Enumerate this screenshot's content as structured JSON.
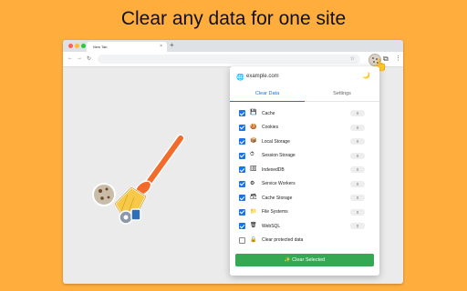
{
  "headline": "Clear any data for one site",
  "browser": {
    "tab_title": "New Tab",
    "tab_close": "×",
    "new_tab": "+",
    "nav": {
      "back": "←",
      "forward": "→",
      "reload": "↻"
    },
    "star": "☆",
    "puzzle": "⧉",
    "menu": "⋮"
  },
  "popup": {
    "site": "example.com",
    "site_icon": "🌐",
    "theme_icon": "🌙",
    "tabs": [
      {
        "label": "Clear Data",
        "active": true
      },
      {
        "label": "Settings",
        "active": false
      }
    ],
    "items": [
      {
        "label": "Cache",
        "icon": "💾",
        "checked": true,
        "count": "0"
      },
      {
        "label": "Cookies",
        "icon": "🍪",
        "checked": true,
        "count": "0"
      },
      {
        "label": "Local Storage",
        "icon": "📦",
        "checked": true,
        "count": "0"
      },
      {
        "label": "Session Storage",
        "icon": "⏱",
        "checked": true,
        "count": "0"
      },
      {
        "label": "IndexedDB",
        "icon": "🗄",
        "checked": true,
        "count": "0"
      },
      {
        "label": "Service Workers",
        "icon": "⚙",
        "checked": true,
        "count": "0"
      },
      {
        "label": "Cache Storage",
        "icon": "🗃",
        "checked": true,
        "count": "0"
      },
      {
        "label": "File Systems",
        "icon": "📁",
        "checked": true,
        "count": "0"
      },
      {
        "label": "WebSQL",
        "icon": "🗑",
        "checked": true,
        "count": "0"
      },
      {
        "label": "Clear protected data",
        "icon": "🔒",
        "checked": false,
        "count": null
      }
    ],
    "clear_button": "✨ Clear Selected"
  },
  "colors": {
    "background": "#FFAE3E",
    "accent": "#1A73E8",
    "button": "#34A853"
  }
}
